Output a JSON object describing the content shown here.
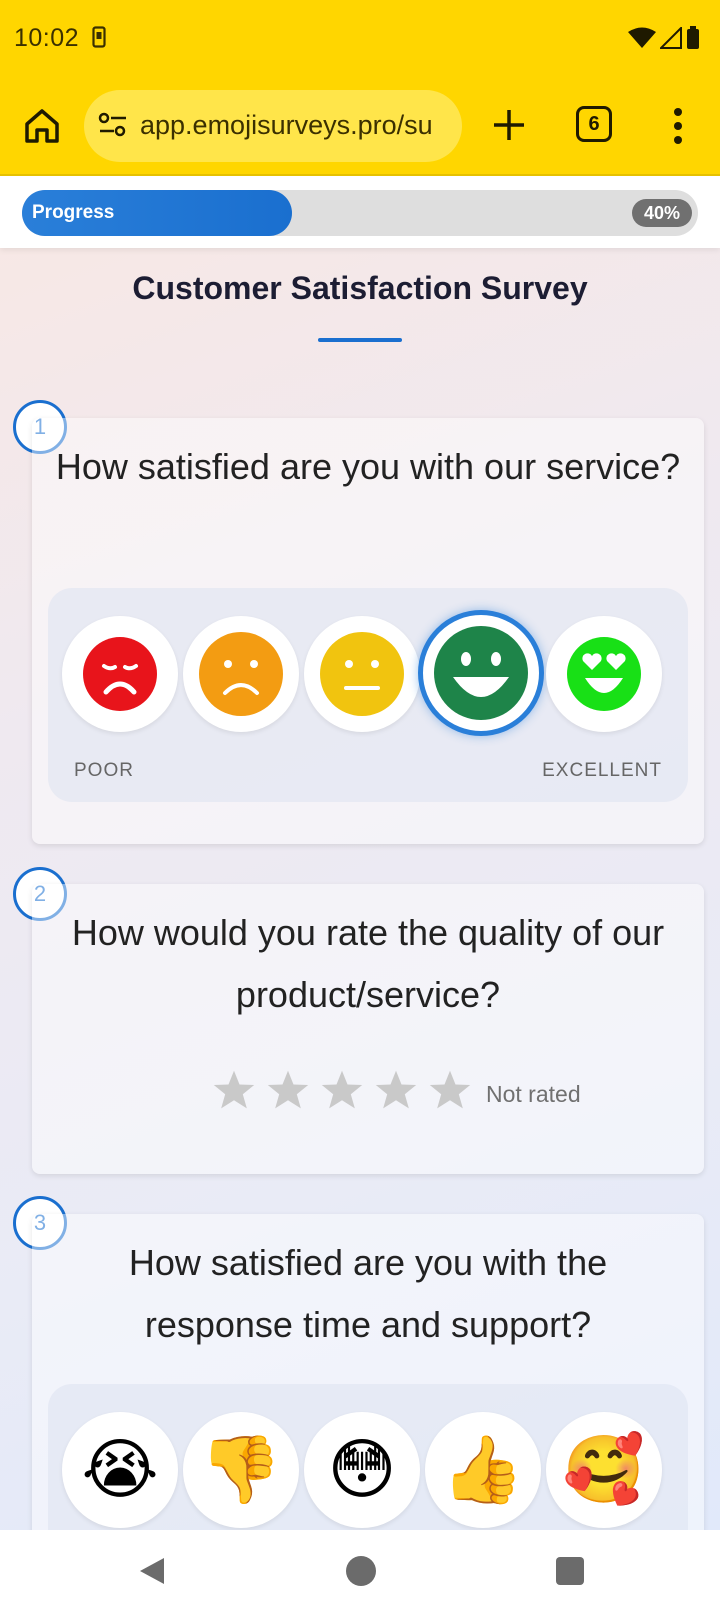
{
  "status_bar": {
    "time": "10:02"
  },
  "browser": {
    "url": "app.emojisurveys.pro/su",
    "tab_count": "6"
  },
  "progress": {
    "label": "Progress",
    "percent_text": "40%",
    "value": 0.4
  },
  "survey": {
    "title": "Customer Satisfaction Survey"
  },
  "questions": [
    {
      "number": "1",
      "text": "How satisfied are you with our service?",
      "scale_low": "POOR",
      "scale_high": "EXCELLENT",
      "options": [
        {
          "icon": "very-sad-face-icon",
          "color": "#E8141B"
        },
        {
          "icon": "sad-face-icon",
          "color": "#F39C12"
        },
        {
          "icon": "neutral-face-icon",
          "color": "#F1C40F"
        },
        {
          "icon": "happy-face-icon",
          "color": "#1E8449"
        },
        {
          "icon": "heart-eyes-face-icon",
          "color": "#18E016"
        }
      ],
      "selected_index": 3
    },
    {
      "number": "2",
      "text": "How would you rate the quality of our product/service?",
      "stars": 5,
      "rating_status": "Not rated"
    },
    {
      "number": "3",
      "text": "How satisfied are you with the response time and support?",
      "options": [
        {
          "icon": "crying-face-icon",
          "glyph": "😭"
        },
        {
          "icon": "thumbs-down-icon",
          "glyph": "👎"
        },
        {
          "icon": "flushed-face-icon",
          "glyph": "😳"
        },
        {
          "icon": "thumbs-up-icon",
          "glyph": "👍"
        },
        {
          "icon": "smiling-face-with-hearts-icon",
          "glyph": "🥰"
        }
      ]
    }
  ]
}
